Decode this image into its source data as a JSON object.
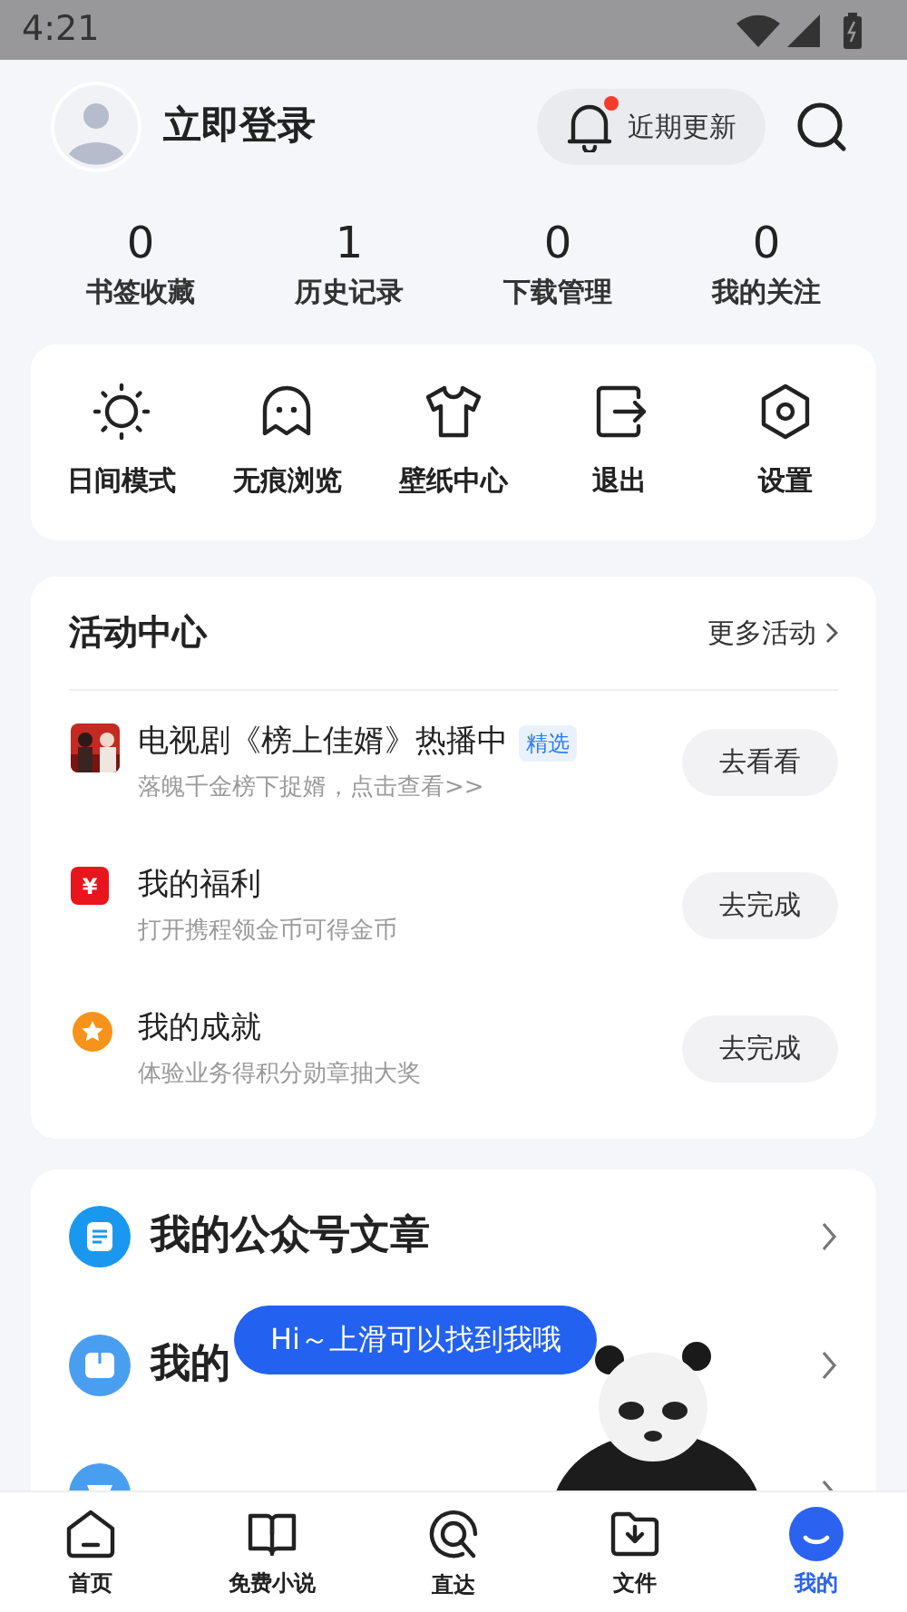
{
  "status_bar": {
    "time": "4:21"
  },
  "header": {
    "login": "立即登录",
    "updates": {
      "label": "近期更新",
      "unread": true
    }
  },
  "stats": [
    {
      "value": "0",
      "label": "书签收藏"
    },
    {
      "value": "1",
      "label": "历史记录"
    },
    {
      "value": "0",
      "label": "下载管理"
    },
    {
      "value": "0",
      "label": "我的关注"
    }
  ],
  "tools": [
    {
      "kind": "sun",
      "label": "日间模式"
    },
    {
      "kind": "ghost",
      "label": "无痕浏览"
    },
    {
      "kind": "shirt",
      "label": "壁纸中心"
    },
    {
      "kind": "exit",
      "label": "退出"
    },
    {
      "kind": "settings",
      "label": "设置"
    }
  ],
  "activity": {
    "title": "活动中心",
    "more": "更多活动",
    "items": [
      {
        "kind": "picture",
        "title": "电视剧《榜上佳婿》热播中",
        "tag": "精选",
        "subtitle": "落魄千金榜下捉婿，点击查看>>",
        "action": "去看看"
      },
      {
        "kind": "yuan",
        "icon_text": "¥",
        "title": "我的福利",
        "subtitle": "打开携程领金币可得金币",
        "action": "去完成"
      },
      {
        "kind": "medal",
        "title": "我的成就",
        "subtitle": "体验业务得积分勋章抽大奖",
        "action": "去完成"
      }
    ]
  },
  "links": [
    {
      "kind": "doc",
      "label": "我的公众号文章"
    },
    {
      "kind": "book",
      "label": "我的"
    },
    {
      "kind": "game"
    }
  ],
  "bubble": "Hi～上滑可以找到我哦",
  "nav": [
    {
      "kind": "home",
      "label": "首页",
      "selected": false
    },
    {
      "kind": "book",
      "label": "免费小说",
      "selected": false
    },
    {
      "kind": "at",
      "label": "直达",
      "selected": false
    },
    {
      "kind": "folder",
      "label": "文件",
      "selected": false
    },
    {
      "kind": "me",
      "label": "我的",
      "selected": true
    }
  ]
}
